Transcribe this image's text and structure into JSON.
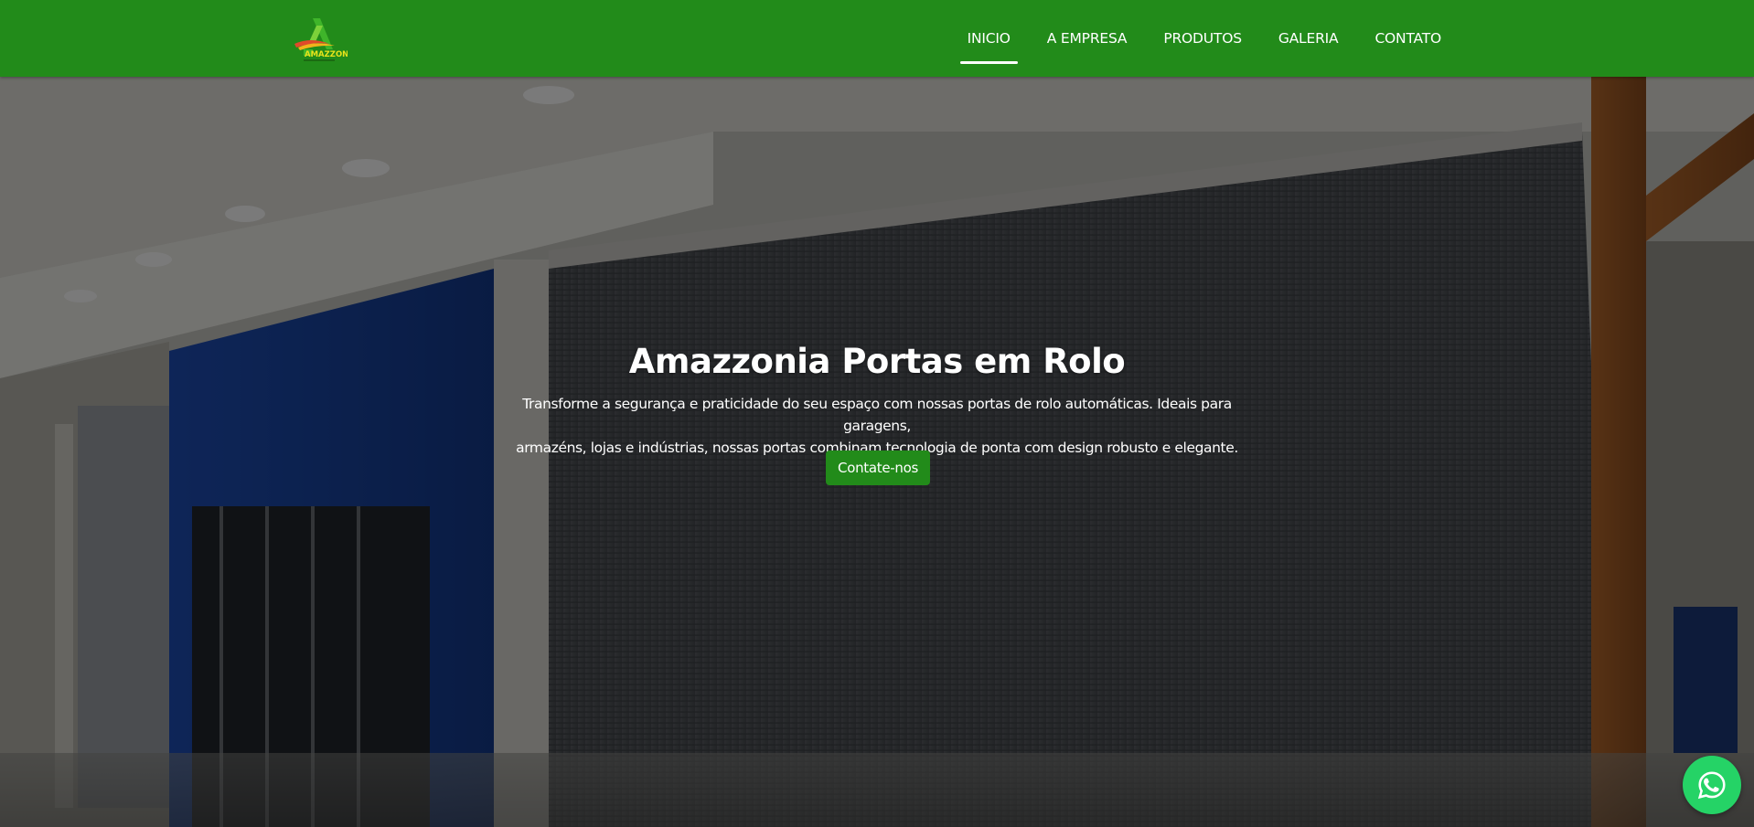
{
  "header": {
    "logo_text": "AMAZZONIA",
    "nav": [
      {
        "label": "INICIO",
        "active": true
      },
      {
        "label": "A EMPRESA",
        "active": false
      },
      {
        "label": "PRODUTOS",
        "active": false
      },
      {
        "label": "GALERIA",
        "active": false
      },
      {
        "label": "CONTATO",
        "active": false
      }
    ]
  },
  "hero": {
    "title": "Amazzonia Portas em Rolo",
    "text_line1": "Transforme a segurança e praticidade do seu espaço com nossas portas de rolo automáticas. Ideais para garagens,",
    "text_line2": "armazéns, lojas e indústrias, nossas portas combinam tecnologia de ponta com design robusto e elegante.",
    "cta_label": "Contate-nos",
    "background": "shopping-mall-storefront-with-closed-roller-door-photo"
  },
  "floating": {
    "whatsapp_icon": "whatsapp-icon"
  },
  "colors": {
    "brand_green": "#228b1a",
    "whatsapp_green": "#25d366",
    "text": "#ffffff"
  }
}
